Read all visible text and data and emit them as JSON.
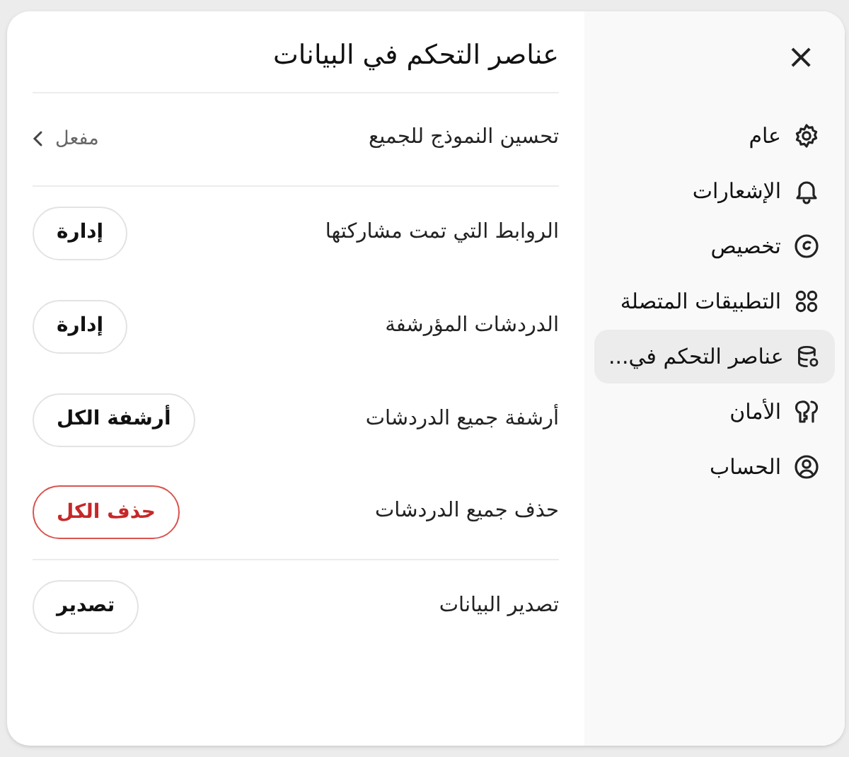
{
  "dialog": {
    "title": "عناصر التحكم في البيانات",
    "close": "×"
  },
  "sidebar": {
    "items": [
      {
        "label": "عام",
        "selected": false
      },
      {
        "label": "الإشعارات",
        "selected": false
      },
      {
        "label": "تخصيص",
        "selected": false
      },
      {
        "label": "التطبيقات المتصلة",
        "selected": false
      },
      {
        "label": "عناصر التحكم في...",
        "selected": true
      },
      {
        "label": "الأمان",
        "selected": false
      },
      {
        "label": "الحساب",
        "selected": false
      }
    ]
  },
  "settings": [
    {
      "kind": "link",
      "label": "تحسين النموذج للجميع",
      "value": "مفعل",
      "divider_after": true
    },
    {
      "kind": "button",
      "label": "الروابط التي تمت مشاركتها",
      "button": "إدارة",
      "danger": false,
      "divider_after": false
    },
    {
      "kind": "button",
      "label": "الدردشات المؤرشفة",
      "button": "إدارة",
      "danger": false,
      "divider_after": false
    },
    {
      "kind": "button",
      "label": "أرشفة جميع الدردشات",
      "button": "أرشفة الكل",
      "danger": false,
      "divider_after": false
    },
    {
      "kind": "button",
      "label": "حذف جميع الدردشات",
      "button": "حذف الكل",
      "danger": true,
      "divider_after": true
    },
    {
      "kind": "button",
      "label": "تصدير البيانات",
      "button": "تصدير",
      "danger": false,
      "divider_after": false
    }
  ]
}
